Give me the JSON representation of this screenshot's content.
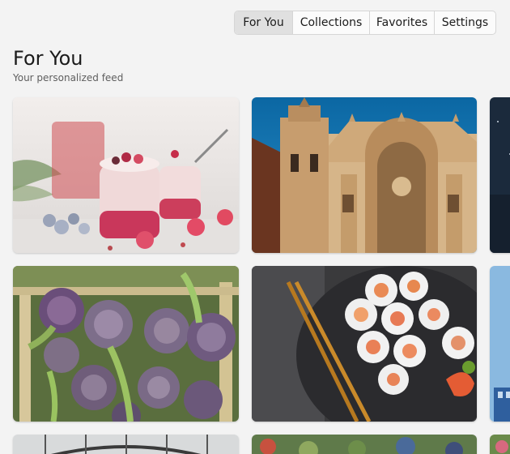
{
  "nav": {
    "tabs": [
      {
        "label": "For You",
        "active": true
      },
      {
        "label": "Collections",
        "active": false
      },
      {
        "label": "Favorites",
        "active": false
      },
      {
        "label": "Settings",
        "active": false
      }
    ]
  },
  "header": {
    "title": "For You",
    "subtitle": "Your personalized feed"
  },
  "feed": {
    "tiles": [
      {
        "subject": "berry-smoothie-jars"
      },
      {
        "subject": "baroque-cathedral-facade"
      },
      {
        "subject": "night-sky"
      },
      {
        "subject": "artichokes-in-crate"
      },
      {
        "subject": "sushi-rolls-with-chopsticks"
      },
      {
        "subject": "modern-building"
      },
      {
        "subject": "greenhouse-roof"
      },
      {
        "subject": "market-produce"
      },
      {
        "subject": "flowers"
      }
    ]
  },
  "colors": {
    "background": "#f3f3f3",
    "active_tab": "#e0e0e0",
    "border": "#d6d6d6"
  }
}
